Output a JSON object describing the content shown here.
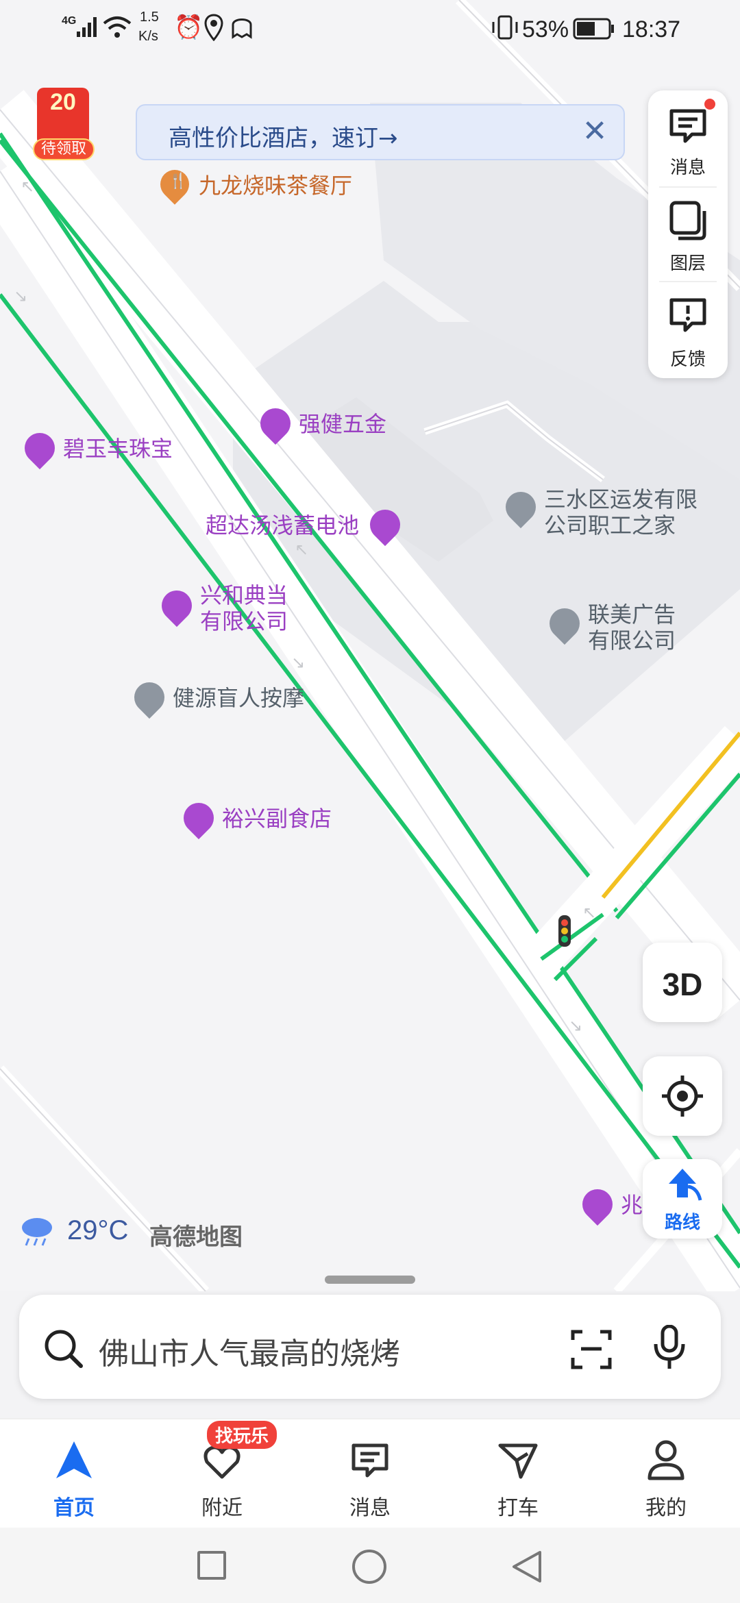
{
  "status_bar": {
    "network": "4G",
    "speed": "1.5",
    "speed_unit": "K/s",
    "battery": "53%",
    "time": "18:37"
  },
  "promo_badge": {
    "number": "20",
    "label": "待领取"
  },
  "banner": {
    "text": "高性价比酒店，速订→"
  },
  "poi": {
    "jiulong": "九龙烧味茶餐厅",
    "qiangjian": "强健五金",
    "biyu": "碧玉丰珠宝",
    "sanshui_line1": "三水区运发有限",
    "sanshui_line2": "公司职工之家",
    "chaoda": "超达汤浅蓄电池",
    "xinghe_line1": "兴和典当",
    "xinghe_line2": "有限公司",
    "lianmei_line1": "联美广告",
    "lianmei_line2": "有限公司",
    "jianyuan": "健源盲人按摩",
    "yuxing": "裕兴副食店",
    "zhao": "兆"
  },
  "right_panel": {
    "messages": "消息",
    "layers": "图层",
    "feedback": "反馈"
  },
  "btn_3d": "3D",
  "route_label": "路线",
  "weather": {
    "temp": "29°C",
    "brand": "高德地图"
  },
  "search": {
    "placeholder": "佛山市人气最高的烧烤"
  },
  "tabs": {
    "home": "首页",
    "nearby": "附近",
    "nearby_badge": "找玩乐",
    "messages": "消息",
    "taxi": "打车",
    "mine": "我的"
  },
  "colors": {
    "accent": "#1a6cf0",
    "road_green": "#1dc46c",
    "poi_purple": "#9a3fc2",
    "badge_red": "#f0413a"
  }
}
